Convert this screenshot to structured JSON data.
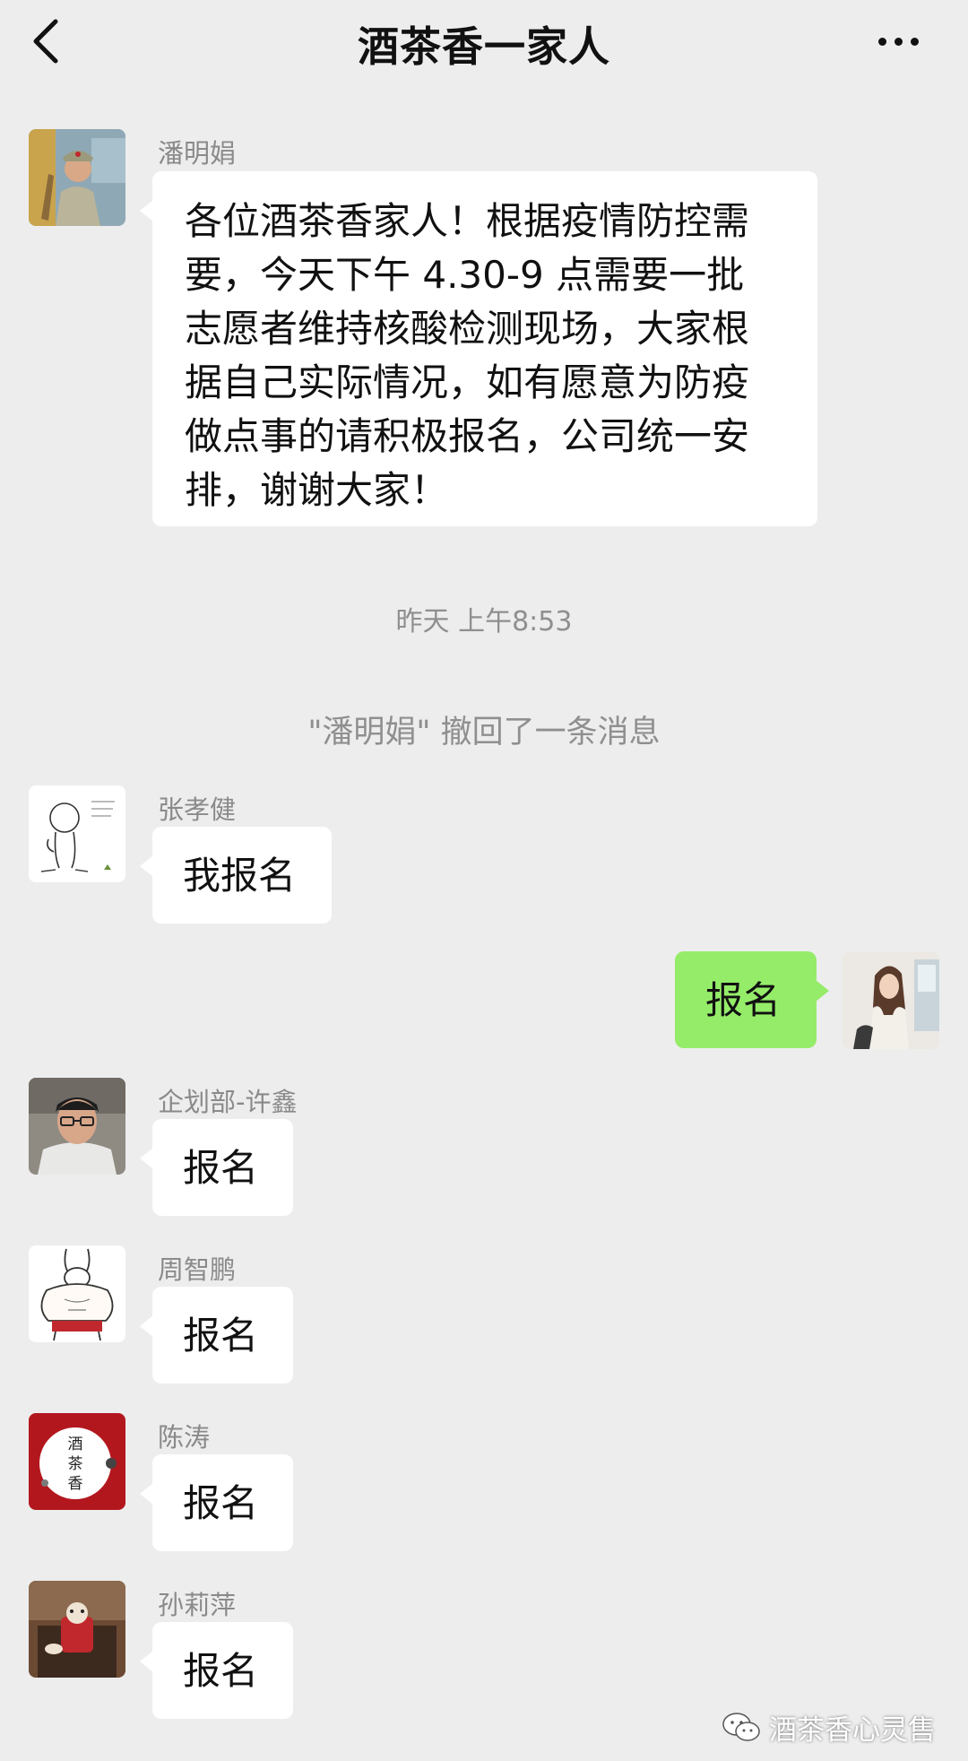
{
  "header": {
    "title": "酒茶香一家人",
    "back_icon": "chevron-left-icon",
    "more_icon": "more-horizontal-icon"
  },
  "messages": [
    {
      "sender": "潘明娟",
      "lines": [
        "各位酒茶香家人！根据疫情防控需",
        "要，今天下午 4.30-9 点需要一批",
        "志愿者维持核酸检测现场，大家根",
        "据自己实际情况，如有愿意为防疫",
        "做点事的请积极报名，公司统一安",
        "排，谢谢大家！"
      ]
    },
    {
      "sender": "张孝健",
      "text": "我报名"
    },
    {
      "sender": "",
      "text": "报名",
      "self": true
    },
    {
      "sender": "企划部-许鑫",
      "text": "报名"
    },
    {
      "sender": "周智鹏",
      "text": "报名"
    },
    {
      "sender": "陈涛",
      "text": "报名",
      "avatar_text": [
        "酒",
        "茶",
        "香"
      ]
    },
    {
      "sender": "孙莉萍",
      "text": "报名"
    }
  ],
  "system": {
    "timestamp": "昨天 上午8:53",
    "recall_notice": "\"潘明娟\" 撤回了一条消息"
  },
  "watermark": {
    "text": "酒茶香心灵售",
    "icon": "wechat-official-account-icon"
  },
  "colors": {
    "background": "#ededed",
    "incoming_bubble": "#ffffff",
    "outgoing_bubble": "#95ec69",
    "meta_text": "#8a8a8a",
    "logo_red": "#b3171e"
  }
}
